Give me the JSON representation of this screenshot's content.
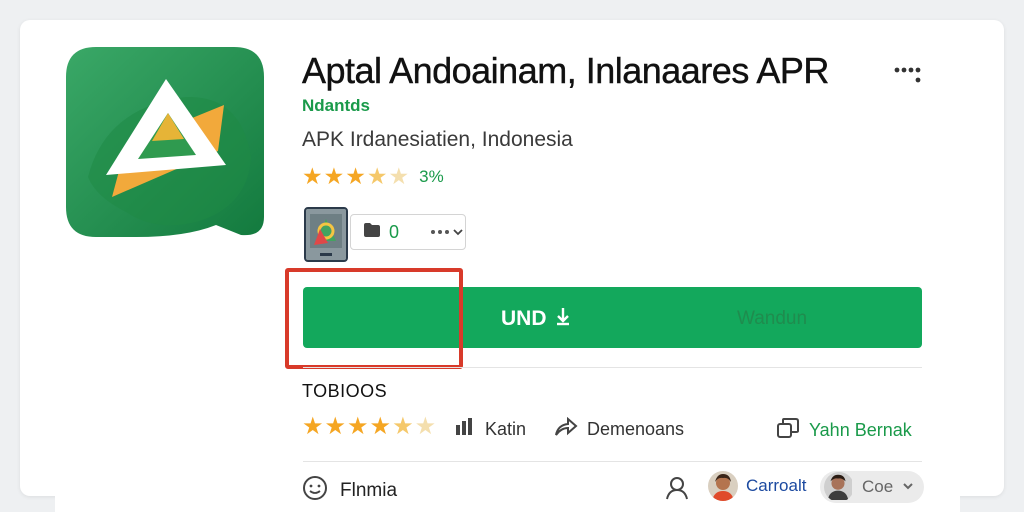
{
  "app": {
    "title": "Aptal Andoainam, Inlanaares APR",
    "developer": "Ndantds",
    "subtitle": "APK Irdanesiatien, Indonesia",
    "rating_value": "3%",
    "rating": 3.5
  },
  "chip": {
    "count": "0"
  },
  "install_button": {
    "label": "UND",
    "secondary_label": "Wandun"
  },
  "details": {
    "section_title": "TOBIOOS",
    "rating": 4.5,
    "stat_1": "Katin",
    "stat_2": "Demenoans",
    "stat_3": "Yahn Bernak"
  },
  "footer": {
    "language": "Flnmia",
    "profile_1_name": "Carroalt",
    "profile_2_name": "Coe"
  },
  "colors": {
    "brand_green": "#13a85c",
    "text_green": "#1a9a4a",
    "star": "#f5a623",
    "highlight": "#d83a2a",
    "link_blue": "#1c4aa0"
  },
  "icons": [
    "app-logo-icon",
    "more-options-icon",
    "folder-icon",
    "download-arrow-icon",
    "bar-chart-icon",
    "share-icon",
    "copy-icon",
    "smiley-icon",
    "user-icon",
    "chevron-down-icon"
  ]
}
